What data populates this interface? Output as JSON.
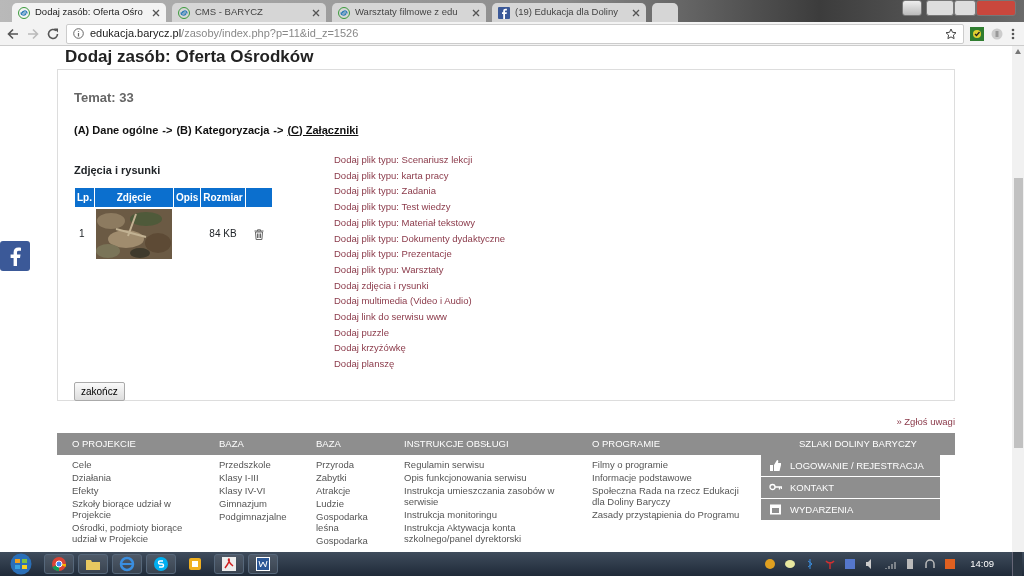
{
  "browser": {
    "tabs": [
      {
        "title": "Dodaj zasób: Oferta Ośro",
        "kind": "site",
        "selected": true
      },
      {
        "title": "CMS - BARYCZ",
        "kind": "site",
        "selected": false
      },
      {
        "title": "Warsztaty filmowe z edu",
        "kind": "site",
        "selected": false
      },
      {
        "title": "(19) Edukacja dla Doliny",
        "kind": "facebook",
        "selected": false
      }
    ],
    "address": {
      "host": "edukacja.barycz.pl",
      "path": "/zasoby/index.php?p=11&id_z=1526"
    }
  },
  "page": {
    "heading": "Dodaj zasób: Oferta Ośrodków",
    "topic": "Temat: 33",
    "steps": [
      {
        "label": "(A) Dane ogólne",
        "arrow": "->",
        "selected": false
      },
      {
        "label": "(B) Kategoryzacja",
        "arrow": "->",
        "selected": false
      },
      {
        "label": "(C) Załączniki",
        "selected": true
      }
    ],
    "section_title": "Zdjęcia i rysunki",
    "table": {
      "columns": [
        "Lp.",
        "Zdjęcie",
        "Opis",
        "Rozmiar"
      ],
      "rows": [
        {
          "lp": "1",
          "size": "84 KB"
        }
      ]
    },
    "add_links": [
      "Dodaj plik typu: Scenariusz lekcji",
      "Dodaj plik typu: karta pracy",
      "Dodaj plik typu: Zadania",
      "Dodaj plik typu: Test wiedzy",
      "Dodaj plik typu: Materiał tekstowy",
      "Dodaj plik typu: Dokumenty dydaktyczne",
      "Dodaj plik typu: Prezentacje",
      "Dodaj plik typu: Warsztaty",
      "Dodaj zdjęcia i rysunki",
      "Dodaj multimedia (Video i Audio)",
      "Dodaj link do serwisu www",
      "Dodaj puzzle",
      "Dodaj krzyżówkę",
      "Dodaj planszę"
    ],
    "finish_button": "zakończ"
  },
  "report_link": "» Zgłoś uwagi",
  "footer": {
    "columns": [
      {
        "heading": "O PROJEKCIE",
        "items": [
          "Cele",
          "Działania",
          "Efekty",
          "Szkoły biorące udział w Projekcie",
          "Ośrodki, podmioty biorące udział w Projekcie"
        ]
      },
      {
        "heading": "BAZA",
        "items": [
          "Przedszkole",
          "Klasy I-III",
          "Klasy IV-VI",
          "Gimnazjum",
          "Podgimnazjalne"
        ]
      },
      {
        "heading": "BAZA",
        "items": [
          "Przyroda",
          "Zabytki",
          "Atrakcje",
          "Ludzie",
          "Gospodarka leśna",
          "Gospodarka"
        ]
      },
      {
        "heading": "INSTRUKCJE OBSŁUGI",
        "items": [
          "Regulamin serwisu",
          "Opis funkcjonowania serwisu",
          "Instrukcja umieszczania zasobów w serwisie",
          "Instrukcja monitoringu",
          "Instrukcja Aktywacja konta szkolnego/panel dyrektorski"
        ]
      },
      {
        "heading": "O PROGRAMIE",
        "items": [
          "Filmy o programie",
          "Informacje podstawowe",
          "Społeczna Rada na rzecz Edukacji dla Doliny Baryczy",
          "Zasady przystąpienia do Programu"
        ]
      }
    ],
    "side": {
      "heading": "SZLAKI DOLINY BARYCZY",
      "items": [
        {
          "kind": "thumb",
          "label": "LOGOWANIE / REJESTRACJA"
        },
        {
          "kind": "key",
          "label": "KONTAKT"
        },
        {
          "kind": "calendar",
          "label": "WYDARZENIA"
        }
      ]
    }
  },
  "taskbar": {
    "clock": "14:09"
  }
}
